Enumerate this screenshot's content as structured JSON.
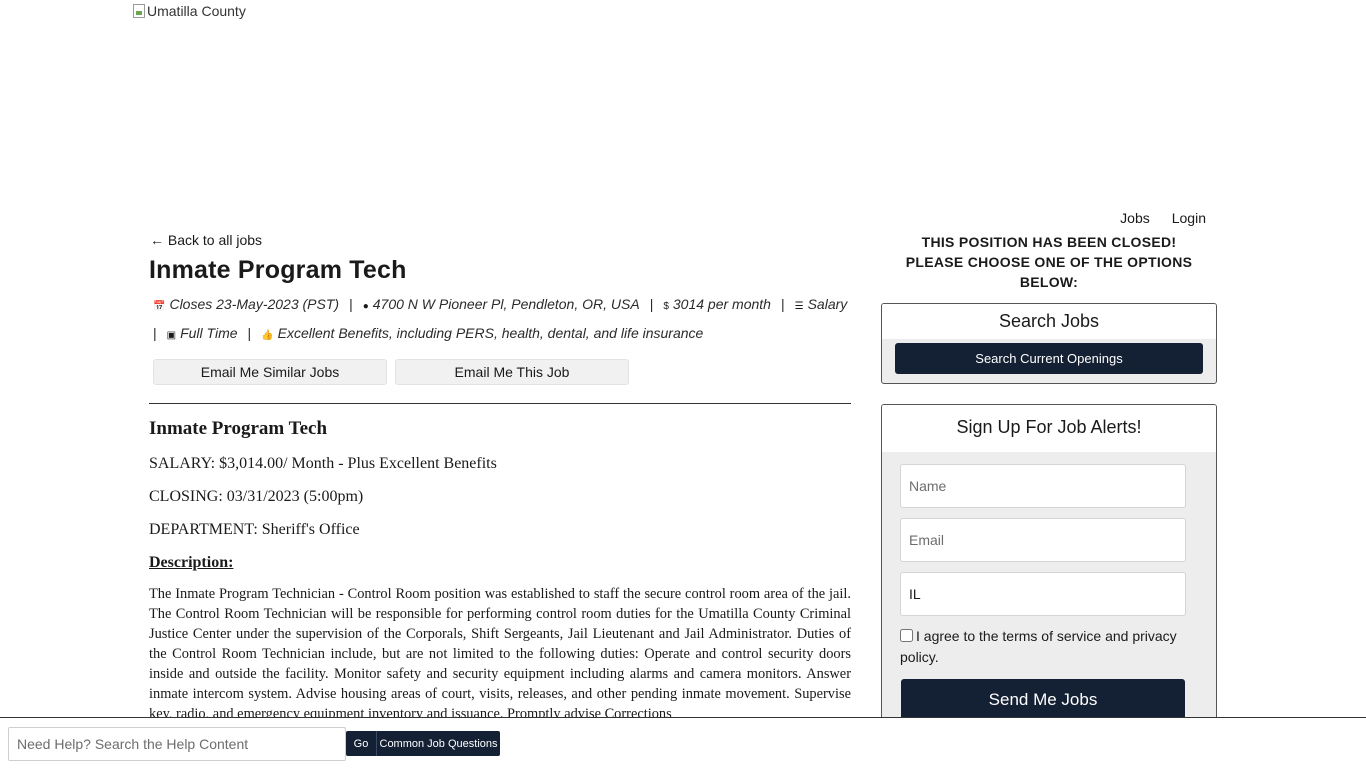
{
  "header": {
    "logo_alt": "Umatilla County",
    "nav": [
      "Jobs",
      "Login"
    ]
  },
  "job": {
    "back_label": "Back to all jobs",
    "title": "Inmate Program Tech",
    "closes": "Closes 23-May-2023 (PST)",
    "location": "4700 N W Pioneer Pl, Pendleton, OR, USA",
    "pay": "3014 per month",
    "pay_type": "Salary",
    "schedule": "Full Time",
    "benefits": "Excellent Benefits, including PERS, health, dental, and life insurance",
    "email_similar_label": "Email Me Similar Jobs",
    "email_job_label": "Email Me This Job"
  },
  "description": {
    "heading": "Inmate Program Tech",
    "salary": "SALARY: $3,014.00/ Month - Plus Excellent Benefits",
    "closing": "CLOSING: 03/31/2023 (5:00pm)",
    "department": "DEPARTMENT: Sheriff's Office",
    "section_title": "Description:",
    "body": "The Inmate Program Technician - Control Room position was established to staff the secure control room area of the jail. The Control Room Technician will be responsible for performing control room duties for the Umatilla County Criminal Justice Center under the supervision of the Corporals, Shift Sergeants, Jail Lieutenant and Jail Administrator. Duties of the Control Room Technician include, but are not limited to the following duties: Operate and control security doors inside and outside the facility. Monitor safety and security equipment including alarms and camera monitors. Answer inmate intercom system. Advise housing areas of court, visits, releases, and other pending inmate movement. Supervise key, radio, and emergency equipment inventory and issuance. Promptly advise Corrections"
  },
  "sidebar": {
    "closed_message": "THIS POSITION HAS BEEN CLOSED! PLEASE CHOOSE ONE OF THE OPTIONS BELOW:",
    "search_title": "Search Jobs",
    "search_button": "Search Current Openings",
    "alerts_title": "Sign Up For Job Alerts!",
    "name_placeholder": "Name",
    "email_placeholder": "Email",
    "location_value": "IL",
    "agree_text": "I agree to the terms of service and privacy policy.",
    "send_button": "Send Me Jobs"
  },
  "help": {
    "placeholder": "Need Help? Search the Help Content",
    "go_label": "Go",
    "questions_label": "Common Job Questions"
  },
  "icons": {
    "calendar": "calendar-icon",
    "location": "map-pin-icon",
    "dollar": "dollar-icon",
    "list": "list-icon",
    "inbox": "inbox-icon",
    "thumbs_up": "thumbs-up-icon",
    "back_arrow": "arrow-left-icon"
  },
  "colors": {
    "primary_button": "#142033",
    "card_background": "#ededed"
  }
}
